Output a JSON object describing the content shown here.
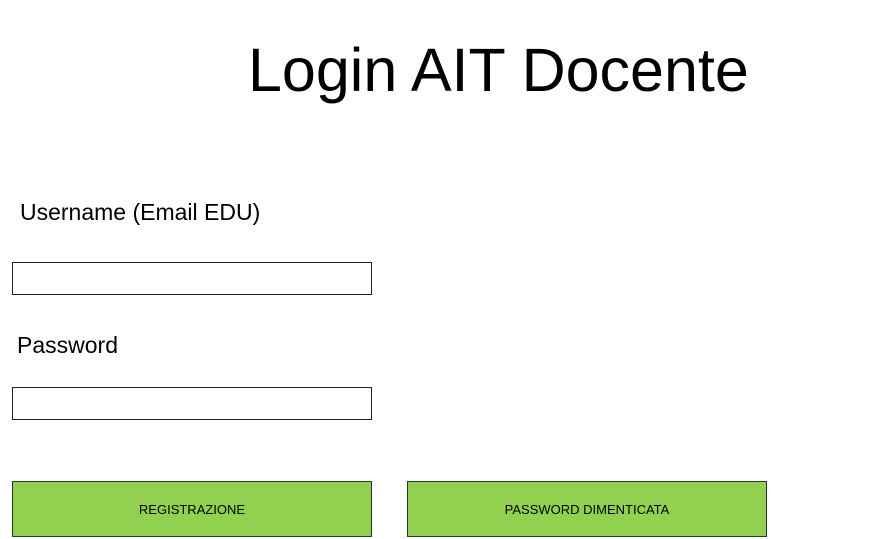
{
  "header": {
    "title": "Login AIT Docente"
  },
  "form": {
    "username_label": "Username (Email EDU)",
    "username_value": "",
    "password_label": "Password",
    "password_value": ""
  },
  "buttons": {
    "register_label": "REGISTRAZIONE",
    "forgot_label": "PASSWORD DIMENTICATA"
  },
  "colors": {
    "button_bg": "#92d050"
  }
}
